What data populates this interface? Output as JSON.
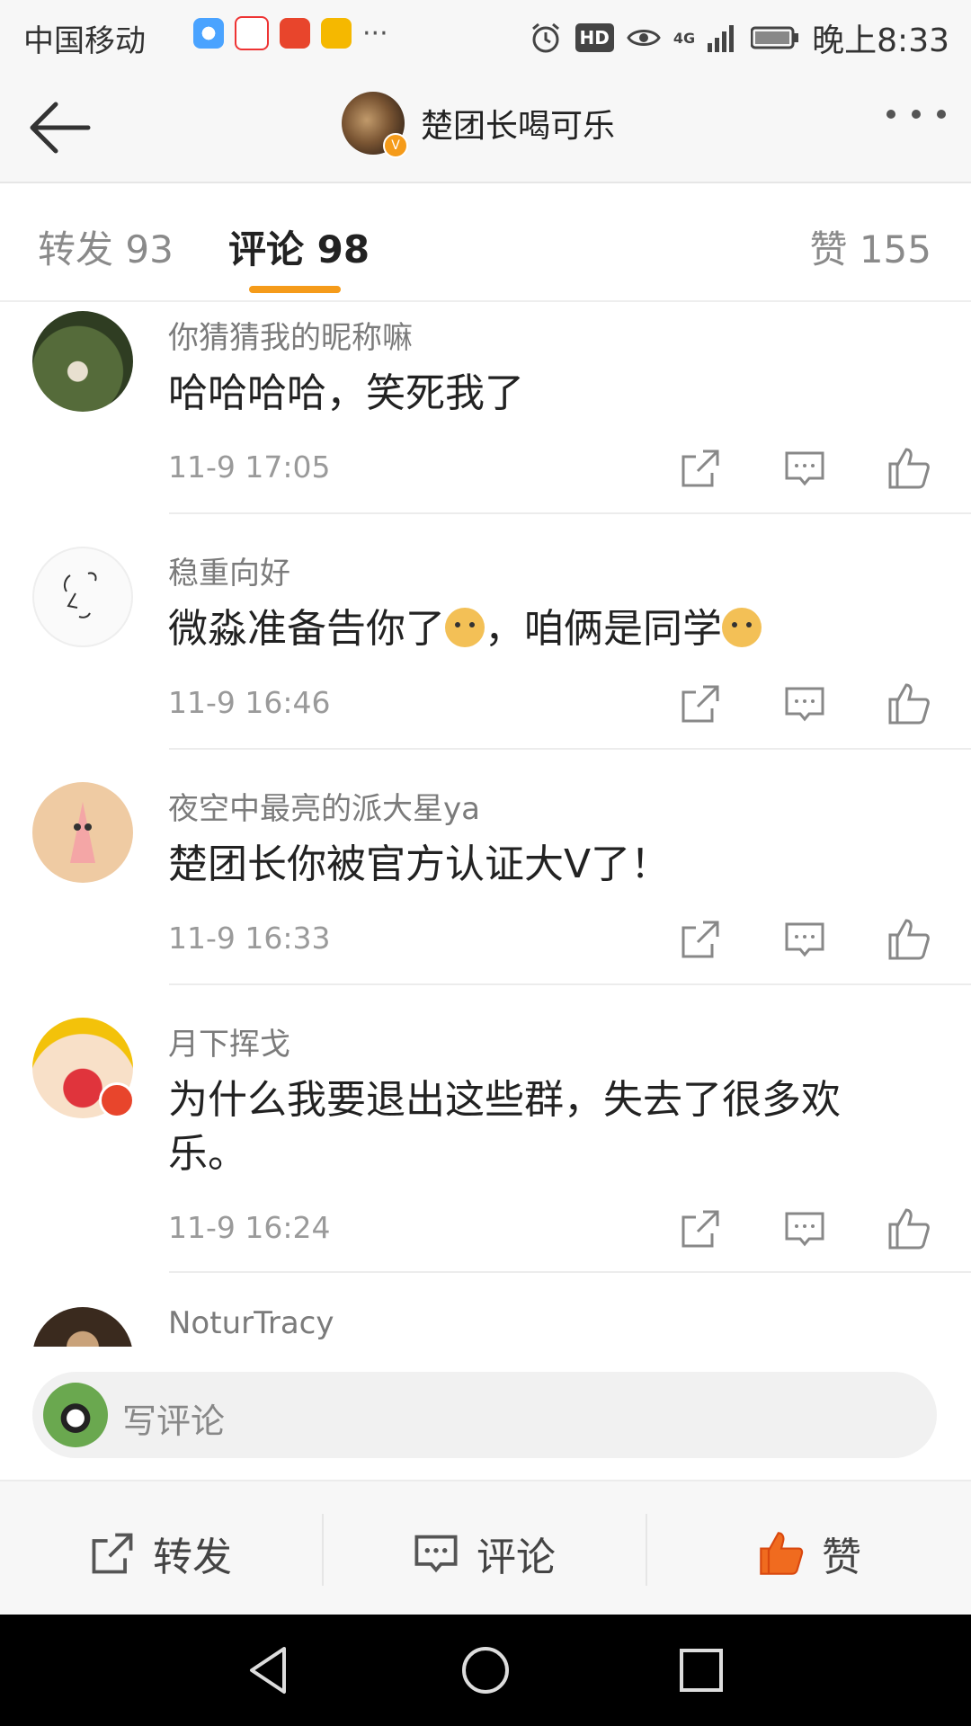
{
  "status_bar": {
    "carrier": "中国移动",
    "time": "晚上8:33",
    "hd_badge": "HD",
    "network": "4G"
  },
  "header": {
    "title": "楚团长喝可乐",
    "verified_badge": "V"
  },
  "tabs": [
    {
      "label": "转发 93"
    },
    {
      "label": "评论 98"
    },
    {
      "label": "赞 155"
    }
  ],
  "comments": [
    {
      "user": "你猜猜我的昵称嘛",
      "text": "哈哈哈哈，笑死我了",
      "time": "11-9 17:05"
    },
    {
      "user": "稳重向好",
      "text_part1": "微淼准备告你了",
      "text_part2": "，咱俩是同学",
      "time": "11-9 16:46"
    },
    {
      "user": "夜空中最亮的派大星ya",
      "text": "楚团长你被官方认证大V了！",
      "time": "11-9 16:33"
    },
    {
      "user": "月下挥戈",
      "text": "为什么我要退出这些群，失去了很多欢乐。",
      "time": "11-9 16:24"
    },
    {
      "user": "NoturTracy"
    }
  ],
  "compose": {
    "placeholder": "写评论"
  },
  "bottom_actions": [
    {
      "label": "转发",
      "icon": "share-icon"
    },
    {
      "label": "评论",
      "icon": "comment-icon"
    },
    {
      "label": "赞",
      "icon": "like-icon"
    }
  ],
  "colors": {
    "accent": "#f59b1a",
    "liked": "#f06b1f"
  }
}
